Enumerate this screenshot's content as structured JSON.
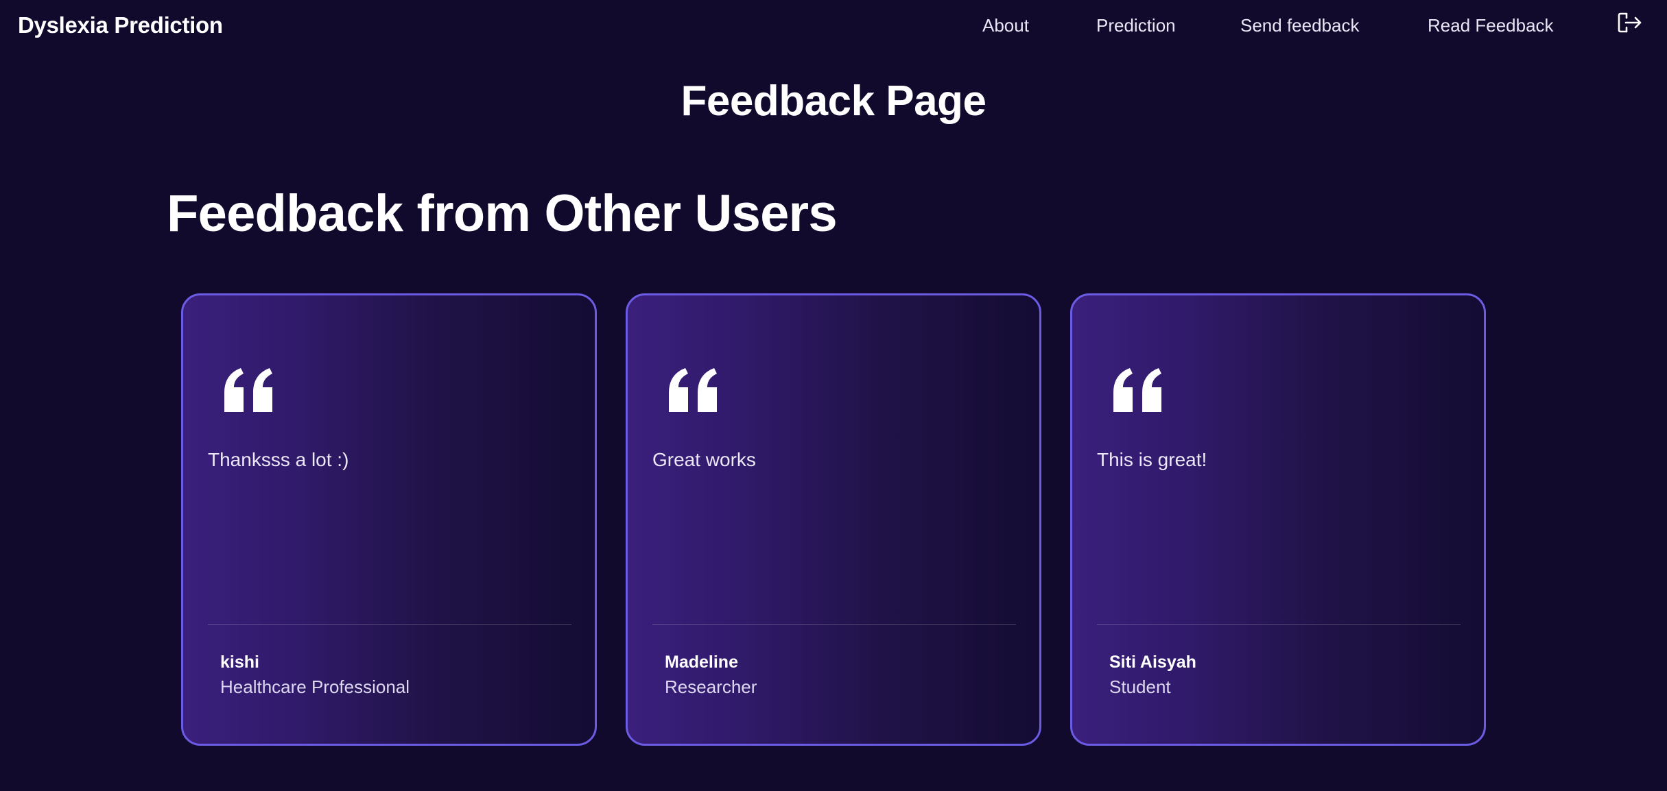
{
  "navbar": {
    "brand": "Dyslexia Prediction",
    "links": [
      {
        "label": "About"
      },
      {
        "label": "Prediction"
      },
      {
        "label": "Send feedback"
      },
      {
        "label": "Read Feedback"
      }
    ],
    "logout_icon": "logout-icon"
  },
  "page": {
    "title": "Feedback Page",
    "section_title": "Feedback from Other Users"
  },
  "feedback": [
    {
      "text": "Thanksss a lot :)",
      "author": "kishi",
      "role": "Healthcare Professional"
    },
    {
      "text": "Great works",
      "author": "Madeline",
      "role": "Researcher"
    },
    {
      "text": "This is great!",
      "author": "Siti Aisyah",
      "role": "Student"
    }
  ],
  "colors": {
    "background": "#110a2c",
    "card_border": "#6b5ce3",
    "card_gradient_start": "#3a1f7c",
    "card_gradient_end": "#140c33"
  },
  "icons": {
    "quote": "quote-icon",
    "logout": "logout-icon"
  }
}
